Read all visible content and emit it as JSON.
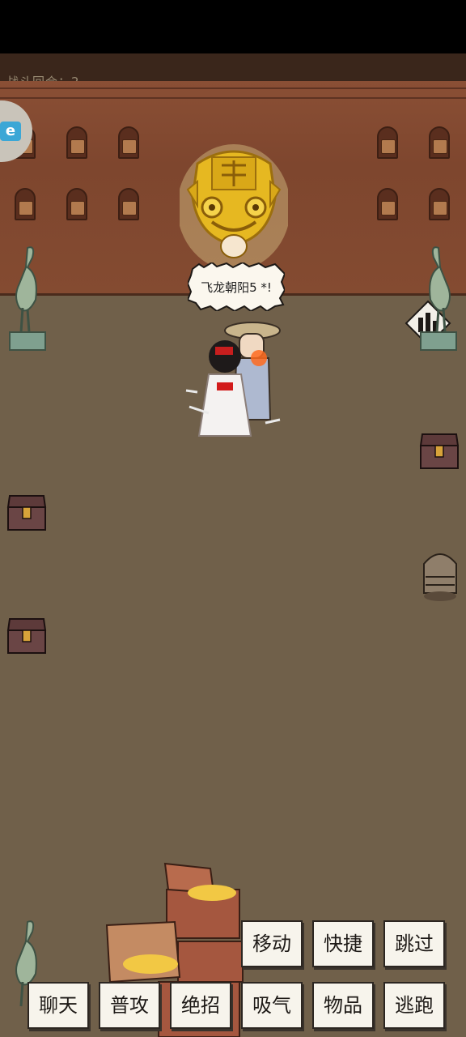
{
  "battle": {
    "turn_label": "战斗回合：2",
    "speech_text": "飞龙朝阳5 *!"
  },
  "actions": {
    "row1": [
      "移动",
      "快捷",
      "跳过"
    ],
    "row2": [
      "聊天",
      "普攻",
      "绝招",
      "吸气",
      "物品",
      "逃跑"
    ]
  },
  "side_icon_letter": "e",
  "icons": [
    "graph-icon",
    "crane-statue",
    "treasure-chest",
    "golden-beast-mask"
  ]
}
